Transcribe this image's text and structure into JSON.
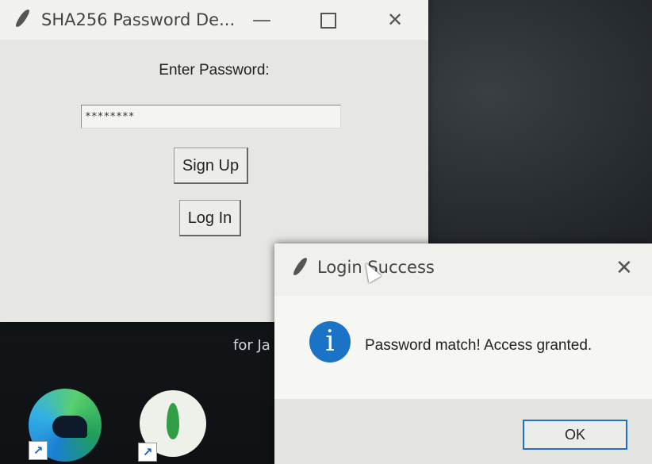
{
  "main_window": {
    "title": "SHA256 Password De...",
    "minimize_glyph": "—",
    "close_glyph": "✕",
    "password_label": "Enter Password:",
    "password_value": "********",
    "signup_label": "Sign Up",
    "login_label": "Log In"
  },
  "dialog": {
    "title": "Login Success",
    "close_glyph": "✕",
    "info_glyph": "i",
    "message": "Password match! Access granted.",
    "ok_label": "OK"
  },
  "desktop": {
    "partial_text": "for Ja",
    "shortcut_glyph": "↗",
    "icons": [
      "edge-icon",
      "mongodb-compass-icon"
    ]
  }
}
